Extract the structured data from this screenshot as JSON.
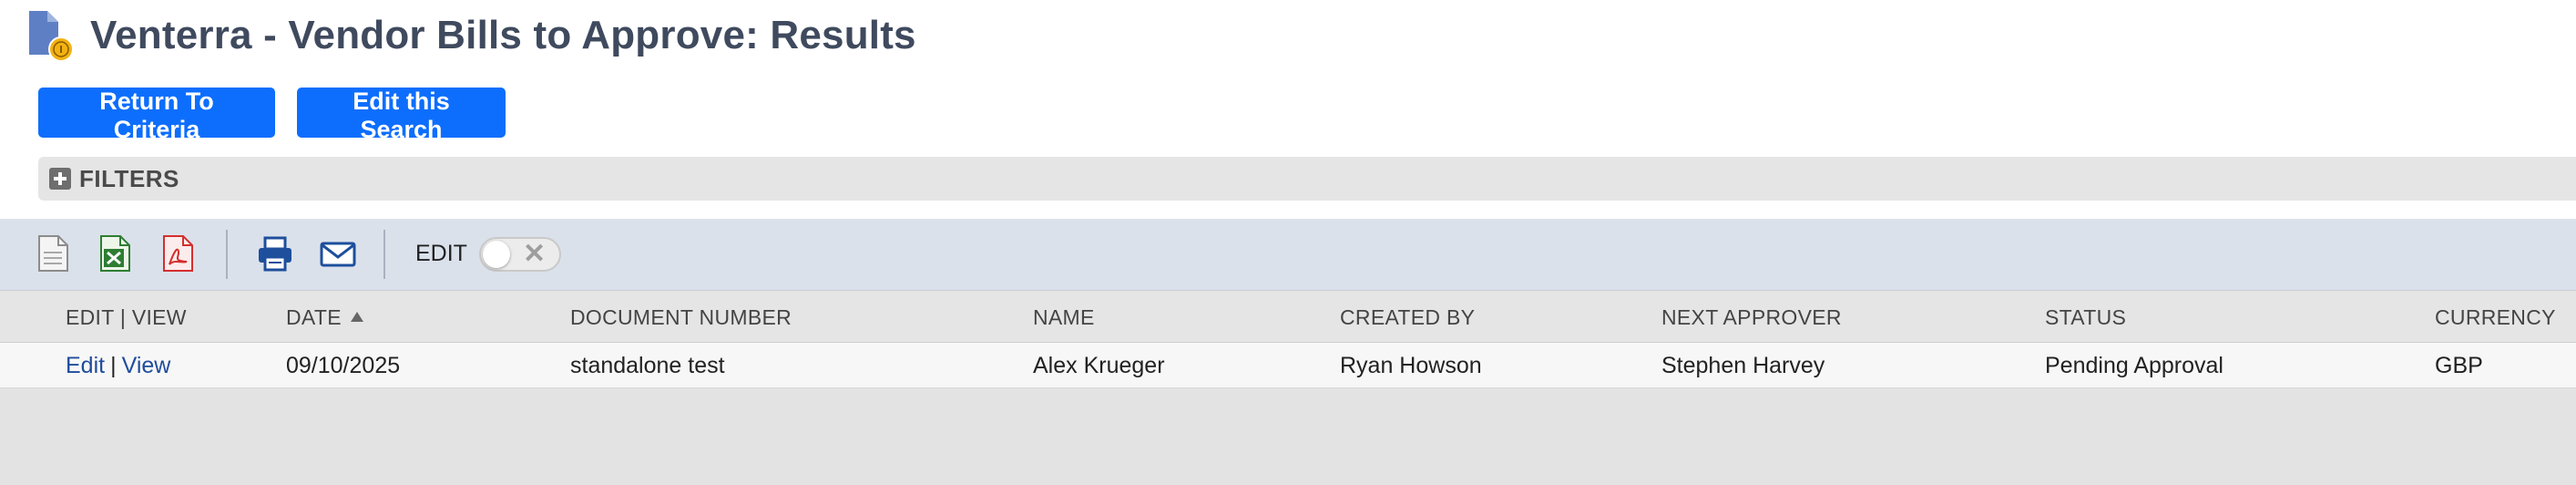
{
  "page": {
    "title": "Venterra - Vendor Bills to Approve: Results",
    "icon": "saved-search-document-icon"
  },
  "actions": {
    "return_label": "Return To Criteria",
    "edit_search_label": "Edit this Search",
    "accent_color": "#0d6efd"
  },
  "filters": {
    "label": "FILTERS",
    "icon": "plus-icon"
  },
  "toolbar": {
    "icons": [
      "export-csv-icon",
      "export-excel-icon",
      "export-pdf-icon",
      "print-icon",
      "email-icon"
    ],
    "edit_label": "EDIT",
    "edit_toggle_on": false
  },
  "table": {
    "columns": [
      "EDIT | VIEW",
      "DATE",
      "DOCUMENT NUMBER",
      "NAME",
      "CREATED BY",
      "NEXT APPROVER",
      "STATUS",
      "CURRENCY"
    ],
    "sorted_column": "DATE",
    "sort_direction": "ascending",
    "rows": [
      {
        "edit": "Edit",
        "view": "View",
        "date": "09/10/2025",
        "document_number": "standalone test",
        "name": "Alex Krueger",
        "created_by": "Ryan Howson",
        "next_approver": "Stephen Harvey",
        "status": "Pending Approval",
        "currency": "GBP"
      }
    ]
  }
}
